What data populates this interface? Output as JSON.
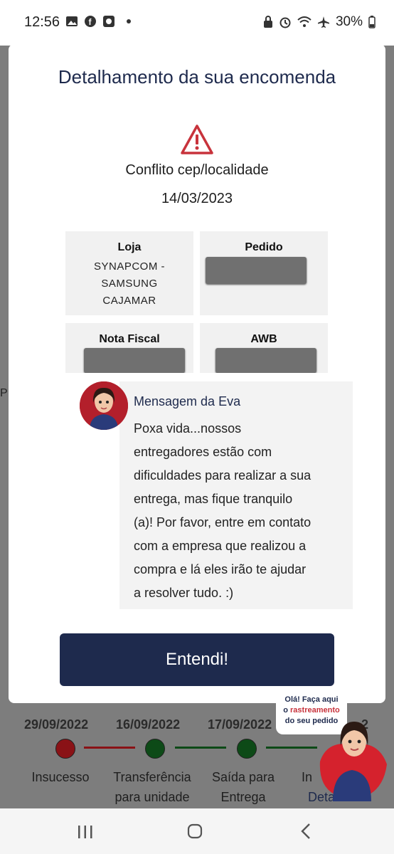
{
  "status_bar": {
    "time": "12:56",
    "battery": "30%",
    "left_icons": [
      "image-icon",
      "facebook-icon",
      "app-icon"
    ],
    "right_icons": [
      "lock-icon",
      "alarm-icon",
      "wifi-icon",
      "airplane-icon",
      "battery-icon"
    ]
  },
  "background": {
    "left_fragment": "P",
    "timeline": {
      "dates": [
        "29/09/2022",
        "16/09/2022",
        "17/09/2022",
        "2"
      ],
      "labels": [
        "Insucesso",
        "Transferência para unidade",
        "Saída para Entrega",
        "In"
      ],
      "details_link": "Detalhes",
      "colors": {
        "fail": "#a3141a",
        "ok": "#0f5b1c"
      }
    }
  },
  "modal": {
    "title": "Detalhamento da sua encomenda",
    "status": "Conflito cep/localidade",
    "date": "14/03/2023",
    "cards": {
      "loja": {
        "label": "Loja",
        "value": "SYNAPCOM - SAMSUNG CAJAMAR"
      },
      "pedido": {
        "label": "Pedido"
      },
      "nota_fiscal": {
        "label": "Nota Fiscal"
      },
      "awb": {
        "label": "AWB"
      }
    },
    "message": {
      "title": "Mensagem da Eva",
      "body": "Poxa vida...nossos entregadores estão com dificuldades para realizar a sua entrega, mas fique tranquilo (a)! Por favor, entre em contato com a empresa que realizou a compra e lá eles irão te ajudar a resolver tudo. :)"
    },
    "button": "Entendi!"
  },
  "mascot": {
    "line1": "Olá! Faça aqui",
    "line2_prefix": "o ",
    "line2_highlight": "rastreamento",
    "line3": "do seu pedido"
  },
  "nav": {
    "icons": [
      "recent-apps-icon",
      "home-icon",
      "back-icon"
    ]
  }
}
